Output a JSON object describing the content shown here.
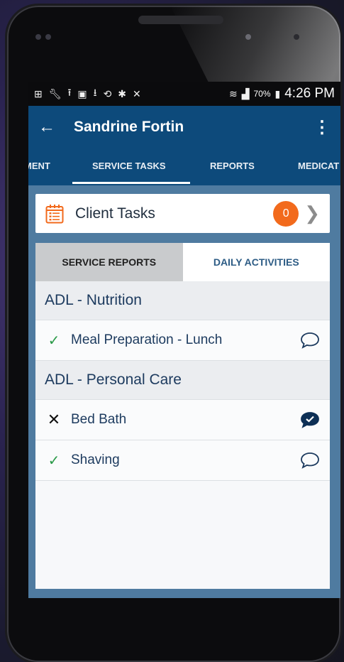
{
  "status_bar": {
    "battery": "70%",
    "time": "4:26 PM",
    "icons": [
      "add-box-icon",
      "wrench-icon",
      "upload-icon",
      "image-icon",
      "download-icon",
      "sync-icon",
      "bluetooth-icon",
      "mute-icon",
      "wifi-icon",
      "signal-icon",
      "battery-icon"
    ]
  },
  "app_bar": {
    "title": "Sandrine Fortin"
  },
  "tabs": [
    {
      "label": "MENT"
    },
    {
      "label": "SERVICE TASKS"
    },
    {
      "label": "REPORTS"
    },
    {
      "label": "MEDICAT"
    }
  ],
  "client_tasks": {
    "label": "Client Tasks",
    "count": "0"
  },
  "segments": [
    {
      "label": "SERVICE REPORTS"
    },
    {
      "label": "DAILY ACTIVITIES"
    }
  ],
  "sections": [
    {
      "title": "ADL - Nutrition",
      "items": [
        {
          "label": "Meal Preparation - Lunch",
          "status": "done",
          "comment": "empty"
        }
      ]
    },
    {
      "title": "ADL - Personal Care",
      "items": [
        {
          "label": "Bed Bath",
          "status": "not-done",
          "comment": "filled"
        },
        {
          "label": "Shaving",
          "status": "done",
          "comment": "empty"
        }
      ]
    }
  ],
  "colors": {
    "app_bar": "#0d4a7b",
    "badge": "#f26a1c",
    "check": "#2a9a48",
    "screen_bg": "#4f7ba0"
  }
}
